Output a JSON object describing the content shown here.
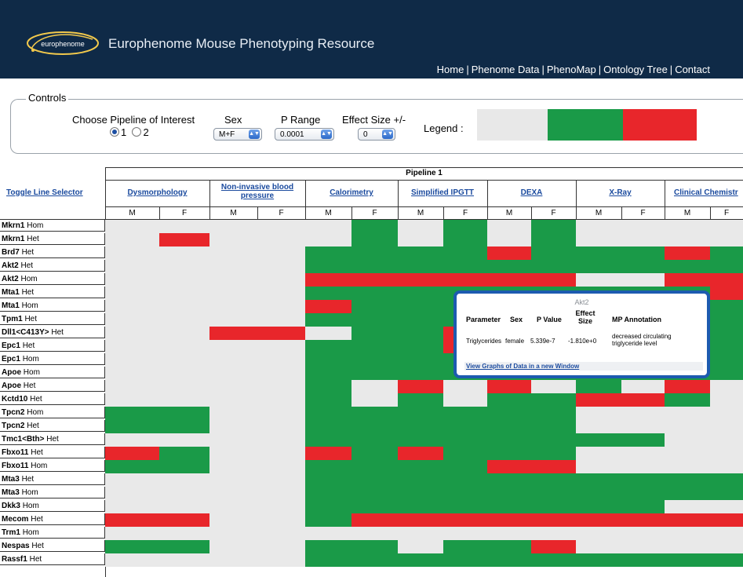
{
  "header": {
    "logo_text": "europhenome",
    "site_title": "Europhenome Mouse Phenotyping Resource",
    "nav": [
      "Home",
      "Phenome Data",
      "PhenoMap",
      "Ontology Tree",
      "Contact"
    ]
  },
  "controls": {
    "title": "Controls",
    "pipeline_label": "Choose Pipeline of Interest",
    "pipeline_options": [
      "1",
      "2"
    ],
    "pipeline_selected": "1",
    "sex_label": "Sex",
    "sex_value": "M+F",
    "prange_label": "P Range",
    "prange_value": "0.0001",
    "effect_label": "Effect Size +/-",
    "effect_value": "0",
    "legend_label": "Legend :",
    "legend_colors": [
      "#e8e8e8",
      "#1a9a48",
      "#e8262b"
    ]
  },
  "grid": {
    "toggle_label": "Toggle Line Selector",
    "pipeline_title": "Pipeline 1",
    "procedures": [
      "Dysmorphology",
      "Non-invasive blood pressure",
      "Calorimetry",
      "Simplified IPGTT",
      "DEXA",
      "X-Ray",
      "Clinical Chemistr"
    ],
    "sex_headers": [
      "M",
      "F"
    ],
    "colors": {
      "N": "#e9e9e9",
      "G": "#1a9a48",
      "R": "#e8262b"
    },
    "rows": [
      {
        "gene": "Mkrn1",
        "zyg": "Hom",
        "cells": "NNNNNGNGNGNNNN"
      },
      {
        "gene": "Mkrn1",
        "zyg": "Het",
        "cells": "NRNNNGNGNGNNNN"
      },
      {
        "gene": "Brd7",
        "zyg": "Het",
        "cells": "NNNNGGGGRGGGRG"
      },
      {
        "gene": "Akt2",
        "zyg": "Het",
        "cells": "NNNNGGGGGGGGGG"
      },
      {
        "gene": "Akt2",
        "zyg": "Hom",
        "cells": "NNNNRRRRRRNNRR"
      },
      {
        "gene": "Mta1",
        "zyg": "Het",
        "cells": "NNNNGGGGGGGGGR"
      },
      {
        "gene": "Mta1",
        "zyg": "Hom",
        "cells": "NNNNRGGGGGGGGG"
      },
      {
        "gene": "Tpm1",
        "zyg": "Het",
        "cells": "NNNNGGGGGGGGGG"
      },
      {
        "gene": "Dll1<C413Y>",
        "zyg": "Het",
        "cells": "NNRRNGGRGGGGGG"
      },
      {
        "gene": "Epc1",
        "zyg": "Het",
        "cells": "NNNNGGGRGGGGGG"
      },
      {
        "gene": "Epc1",
        "zyg": "Hom",
        "cells": "NNNNGGGGGGGGGG"
      },
      {
        "gene": "Apoe",
        "zyg": "Hom",
        "cells": "NNNNGGGGGGGGGG"
      },
      {
        "gene": "Apoe",
        "zyg": "Het",
        "cells": "NNNNGNRNRNGNRN"
      },
      {
        "gene": "Kctd10",
        "zyg": "Het",
        "cells": "NNNNGNGNGGRRGN"
      },
      {
        "gene": "Tpcn2",
        "zyg": "Hom",
        "cells": "GGNNGGGGGGNNNN"
      },
      {
        "gene": "Tpcn2",
        "zyg": "Het",
        "cells": "GGNNGGGGGGNNNN"
      },
      {
        "gene": "Tmc1<Bth>",
        "zyg": "Het",
        "cells": "NNNNGGGGGGGGNN"
      },
      {
        "gene": "Fbxo11",
        "zyg": "Het",
        "cells": "RGNNRGRGGGNNNN"
      },
      {
        "gene": "Fbxo11",
        "zyg": "Hom",
        "cells": "GGNNGGGGRRNNNN"
      },
      {
        "gene": "Mta3",
        "zyg": "Het",
        "cells": "NNNNGGGGGGGGGG"
      },
      {
        "gene": "Mta3",
        "zyg": "Hom",
        "cells": "NNNNGGGGGGGGGG"
      },
      {
        "gene": "Dkk3",
        "zyg": "Hom",
        "cells": "NNNNGGGGGGGGNN"
      },
      {
        "gene": "Mecom",
        "zyg": "Het",
        "cells": "RRNNGRRRRRRRRR"
      },
      {
        "gene": "Trm1",
        "zyg": "Hom",
        "cells": "NNNNNNNNNNNNNN"
      },
      {
        "gene": "Nespas",
        "zyg": "Het",
        "cells": "GGNNGGNGGRNNNN"
      },
      {
        "gene": "Rassf1",
        "zyg": "Het",
        "cells": "NNNNGGGGGGGGGG"
      }
    ]
  },
  "popup": {
    "title": "Akt2",
    "headers": [
      "Parameter",
      "Sex",
      "P Value",
      "Effect Size",
      "MP Annotation"
    ],
    "row": [
      "Triglycerides",
      "female",
      "5.339e-7",
      "-1.810e+0",
      "decreased circulating triglyceride level"
    ],
    "link": "View Graphs of Data in a new Window"
  }
}
